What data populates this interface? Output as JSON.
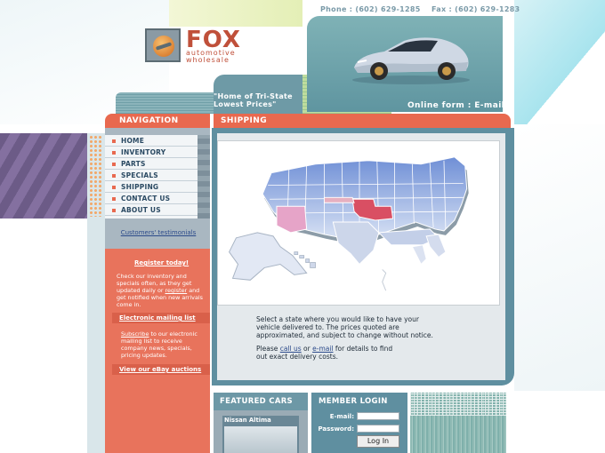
{
  "header": {
    "phone_label": "Phone :",
    "phone": "(602) 629-1285",
    "fax_label": "Fax :",
    "fax": "(602) 629-1283",
    "logo_name": "FOX",
    "logo_sub1": "automotive",
    "logo_sub2": "wholesale",
    "tagline_line1": "\"Home of Tri-State",
    "tagline_line2": "Lowest Prices\"",
    "online_form": "Online form : E-mail"
  },
  "nav": {
    "title": "NAVIGATION",
    "items": [
      {
        "label": "HOME"
      },
      {
        "label": "INVENTORY"
      },
      {
        "label": "PARTS"
      },
      {
        "label": "SPECIALS"
      },
      {
        "label": "SHIPPING"
      },
      {
        "label": "CONTACT US"
      },
      {
        "label": "ABOUT US"
      }
    ],
    "testimonials": "Customers' testimonials"
  },
  "promo": {
    "register_link": "Register today!",
    "register_text1": "Check our inventory and",
    "register_text2": "specials often, as they get",
    "register_text3_pre": "updated daily or ",
    "register_text3_link": "register",
    "register_text3_post": " and",
    "register_text4": "get notified when new arrivals",
    "register_text5": "come in.",
    "mailing_title": "Electronic mailing list",
    "mailing_link": "Subscribe",
    "mailing_text1": " to our electronic",
    "mailing_text2": "mailing list to receive",
    "mailing_text3": "company news, specials,",
    "mailing_text4": "pricing updates.",
    "ebay": "View our eBay auctions"
  },
  "shipping": {
    "title": "SHIPPING",
    "text_line1": "Select a state where you would like to have your",
    "text_line2": "vehicle delivered to. The prices quoted are",
    "text_line3": "approximated, and subject to change without notice.",
    "text2_pre": "Please ",
    "call_us": "call us",
    "text2_mid": " or ",
    "email": "e-mail",
    "text2_post": " for details to find",
    "text2_line2": "out exact delivery costs."
  },
  "featured": {
    "title": "FEATURED CARS",
    "car_name": "Nissan Altima"
  },
  "member": {
    "title": "MEMBER LOGIN",
    "email_label": "E-mail:",
    "password_label": "Password:",
    "login_button": "Log In"
  },
  "colors": {
    "accent_red": "#e8694f",
    "teal": "#5f8fa0",
    "nav_text": "#2b4a63"
  }
}
